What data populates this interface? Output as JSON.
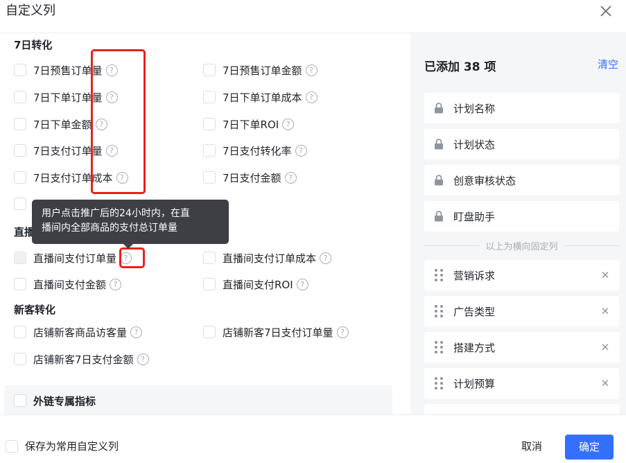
{
  "dialog": {
    "title": "自定义列",
    "close_icon": "close-icon"
  },
  "sections": {
    "day7": {
      "title": "7日转化",
      "items": [
        {
          "label": "7日预售订单量"
        },
        {
          "label": "7日预售订单金额"
        },
        {
          "label": "7日下单订单量"
        },
        {
          "label": "7日下单订单成本"
        },
        {
          "label": "7日下单金额"
        },
        {
          "label": "7日下单ROI"
        },
        {
          "label": "7日支付订单量"
        },
        {
          "label": "7日支付转化率"
        },
        {
          "label": "7日支付订单成本"
        },
        {
          "label": "7日支付金额"
        }
      ]
    },
    "live": {
      "title": "直播",
      "items": [
        {
          "label": "直播间支付订单量",
          "disabled": true
        },
        {
          "label": "直播间支付订单成本"
        },
        {
          "label": "直播间支付金额"
        },
        {
          "label": "直播间支付ROI"
        }
      ]
    },
    "newcust": {
      "title": "新客转化",
      "items": [
        {
          "label": "店铺新客商品访客量"
        },
        {
          "label": "店铺新客7日支付订单量"
        },
        {
          "label": "店铺新客7日支付金额"
        }
      ]
    },
    "external": {
      "label": "外链专属指标"
    }
  },
  "tooltip": {
    "line1": "用户点击推广后的24小时内，在直",
    "line2": "播间内全部商品的支付总订单量"
  },
  "selected": {
    "title": "已添加 38 项",
    "clear_label": "清空",
    "fixed": [
      {
        "label": "计划名称"
      },
      {
        "label": "计划状态"
      },
      {
        "label": "创意审核状态"
      },
      {
        "label": "盯盘助手"
      }
    ],
    "divider_text": "以上为横向固定列",
    "movable": [
      {
        "label": "营销诉求"
      },
      {
        "label": "广告类型"
      },
      {
        "label": "搭建方式"
      },
      {
        "label": "计划预算"
      }
    ],
    "remove_glyph": "✕"
  },
  "footer": {
    "save_label": "保存为常用自定义列",
    "cancel_label": "取消",
    "confirm_label": "确定"
  },
  "colors": {
    "accent": "#3370ff",
    "highlight": "#e8201d",
    "tooltip_bg": "#3d3f44"
  }
}
